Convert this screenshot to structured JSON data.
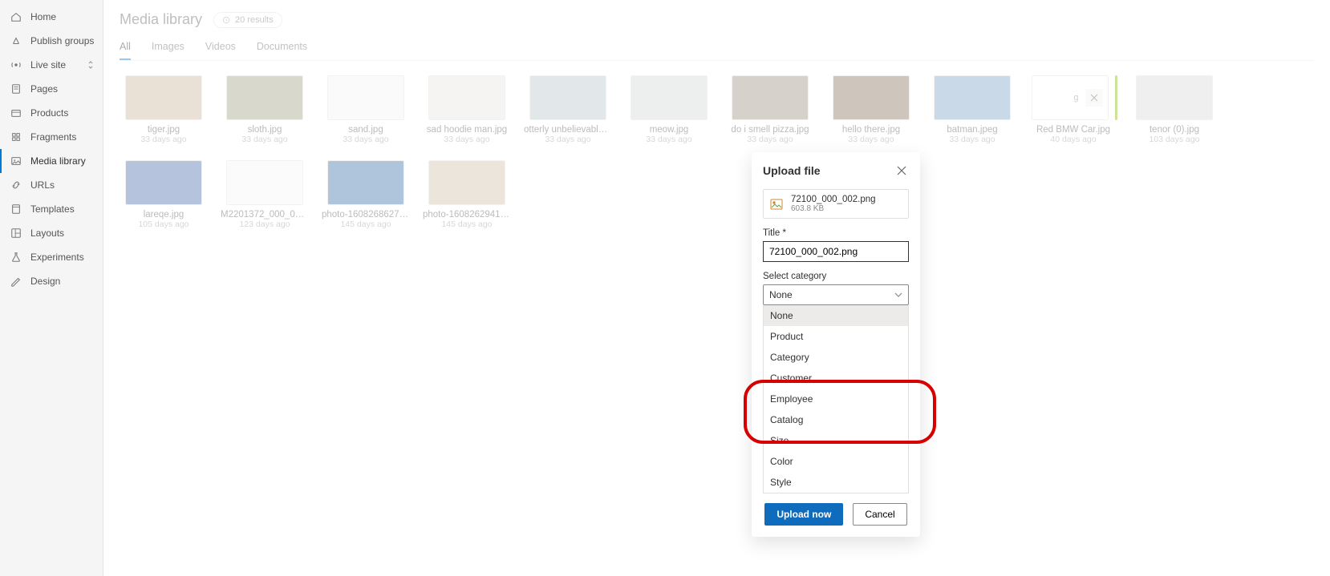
{
  "sidebar": {
    "items": [
      {
        "key": "home",
        "label": "Home",
        "icon": "home-icon"
      },
      {
        "key": "publish",
        "label": "Publish groups",
        "icon": "publish-icon"
      },
      {
        "key": "live",
        "label": "Live site",
        "icon": "live-icon",
        "updown": true
      },
      {
        "key": "pages",
        "label": "Pages",
        "icon": "pages-icon"
      },
      {
        "key": "products",
        "label": "Products",
        "icon": "products-icon"
      },
      {
        "key": "fragments",
        "label": "Fragments",
        "icon": "fragments-icon"
      },
      {
        "key": "media",
        "label": "Media library",
        "icon": "media-icon",
        "active": true
      },
      {
        "key": "urls",
        "label": "URLs",
        "icon": "urls-icon"
      },
      {
        "key": "templates",
        "label": "Templates",
        "icon": "templates-icon"
      },
      {
        "key": "layouts",
        "label": "Layouts",
        "icon": "layouts-icon"
      },
      {
        "key": "experiments",
        "label": "Experiments",
        "icon": "experiments-icon"
      },
      {
        "key": "design",
        "label": "Design",
        "icon": "design-icon"
      }
    ]
  },
  "header": {
    "title": "Media library",
    "badge": "20 results"
  },
  "tabs": [
    {
      "key": "all",
      "label": "All",
      "active": true
    },
    {
      "key": "images",
      "label": "Images"
    },
    {
      "key": "videos",
      "label": "Videos"
    },
    {
      "key": "documents",
      "label": "Documents"
    }
  ],
  "items": [
    {
      "name": "tiger.jpg",
      "age": "33 days ago",
      "hue": "#c8b29a"
    },
    {
      "name": "sloth.jpg",
      "age": "33 days ago",
      "hue": "#9fa07f"
    },
    {
      "name": "sand.jpg",
      "age": "33 days ago",
      "hue": "#f2f2f2"
    },
    {
      "name": "sad hoodie man.jpg",
      "age": "33 days ago",
      "hue": "#e8e3de"
    },
    {
      "name": "otterly unbelievable.j...",
      "age": "33 days ago",
      "hue": "#b7c3c8"
    },
    {
      "name": "meow.jpg",
      "age": "33 days ago",
      "hue": "#d3d6d8"
    },
    {
      "name": "do i smell pizza.jpg",
      "age": "33 days ago",
      "hue": "#9a8f7e"
    },
    {
      "name": "hello there.jpg",
      "age": "33 days ago",
      "hue": "#856f58"
    },
    {
      "name": "batman.jpeg",
      "age": "33 days ago",
      "hue": "#7aa0c4"
    },
    {
      "name": "Red BMW Car.jpg",
      "age": "40 days ago",
      "dropzone": true
    },
    {
      "name": "tenor (0).jpg",
      "age": "103 days ago",
      "hue": "#d7d7d7"
    },
    {
      "name": "lareqe.jpg",
      "age": "105 days ago",
      "hue": "#4a6aa8"
    },
    {
      "name": "M2201372_000_002.p...",
      "age": "123 days ago",
      "hue": "#f5f5f5"
    },
    {
      "name": "photo-160826862760...",
      "age": "145 days ago",
      "hue": "#356ea6"
    },
    {
      "name": "photo-160826294108...",
      "age": "145 days ago",
      "hue": "#cfbfa7"
    }
  ],
  "dialog": {
    "title": "Upload file",
    "file": {
      "name": "72100_000_002.png",
      "size": "603.8 KB"
    },
    "title_field_label": "Title *",
    "title_field_value": "72100_000_002.png",
    "category_label": "Select category",
    "category_value": "None",
    "options": [
      "None",
      "Product",
      "Category",
      "Customer",
      "Employee",
      "Catalog",
      "Size",
      "Color",
      "Style"
    ],
    "primary": "Upload now",
    "secondary": "Cancel"
  }
}
